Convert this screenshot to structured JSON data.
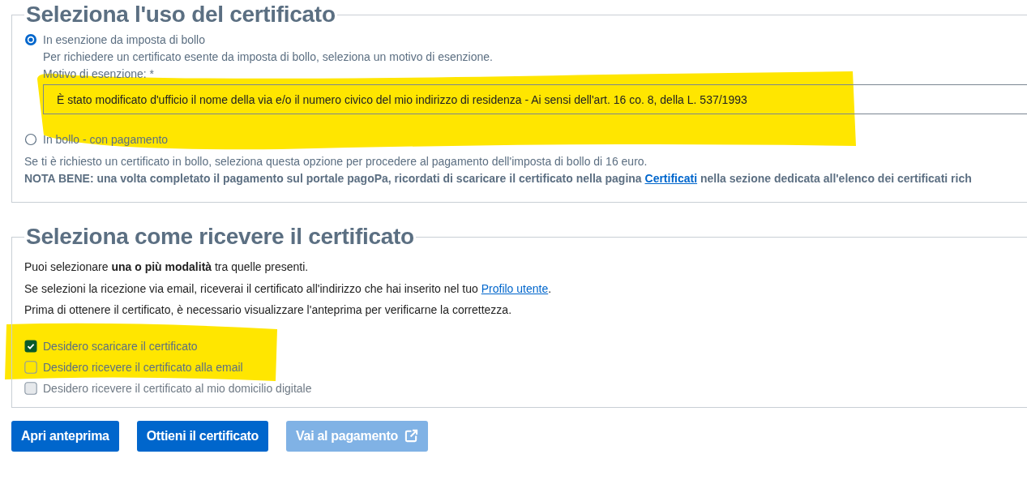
{
  "usage": {
    "title": "Seleziona l'uso del certificato",
    "options": [
      {
        "label": "In esenzione da imposta di bollo",
        "selected": true,
        "hint": "Per richiedere un certificato esente da imposta di bollo, seleziona un motivo di esenzione.",
        "field": {
          "label": "Motivo di esenzione: *",
          "value": "È stato modificato d'ufficio il nome della via e/o il numero civico del mio indirizzo di residenza - Ai sensi dell'art. 16 co. 8, della L. 537/1993"
        }
      },
      {
        "label": "In bollo - con pagamento",
        "selected": false
      }
    ],
    "description": "Se ti è richiesto un certificato in bollo, seleziona questa opzione per procedere al pagamento dell'imposta di bollo di 16 euro.",
    "note": {
      "before": "NOTA BENE: una volta completato il pagamento sul portale pagoPa, ricordati di scaricare il certificato nella pagina ",
      "link": "Certificati",
      "after": " nella sezione dedicata all'elenco dei certificati rich"
    }
  },
  "delivery": {
    "title": "Seleziona come ricevere il certificato",
    "intro": "Puoi selezionare **una o più modalità** tra quelle presenti.",
    "email_note": {
      "before": "Se selezioni la ricezione via email, riceverai il certificato all'indirizzo che hai inserito nel tuo ",
      "link": "Profilo utente",
      "after": "."
    },
    "preview_note": "Prima di ottenere il certificato, è necessario visualizzare l'anteprima per verificarne la correttezza.",
    "options": [
      {
        "label": "Desidero scaricare il certificato",
        "checked": true,
        "disabled": false
      },
      {
        "label": "Desidero ricevere il certificato alla email",
        "checked": false,
        "disabled": false
      },
      {
        "label": "Desidero ricevere il certificato al mio domicilio digitale",
        "checked": false,
        "disabled": true
      }
    ]
  },
  "buttons": [
    {
      "label": "Apri anteprima",
      "disabled": false,
      "kind": "plain"
    },
    {
      "label": "Ottieni il certificato",
      "disabled": false,
      "kind": "plain"
    },
    {
      "label": "Vai al pagamento",
      "disabled": true,
      "kind": "external"
    }
  ]
}
